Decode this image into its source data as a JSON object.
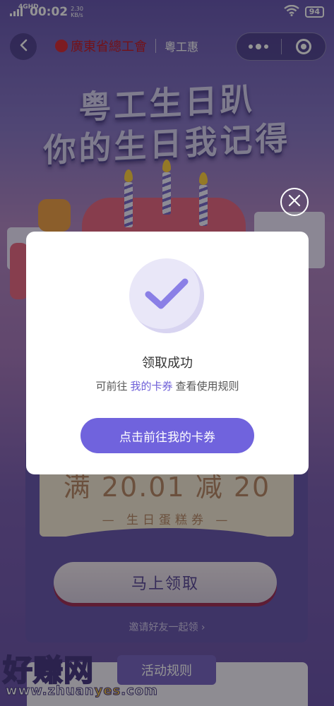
{
  "status_bar": {
    "network": "4GHD",
    "time": "00:02",
    "speed_value": "2.30",
    "speed_unit": "KB/s",
    "battery": "94"
  },
  "navbar": {
    "brand_name": "廣東省總工會",
    "brand_sub": "粵工惠"
  },
  "banner": {
    "line1": "粤工生日趴",
    "line2": "你的生日我记得"
  },
  "coupon": {
    "amount_text": "满 20.01 减 20",
    "name": "— 生日蛋糕券 —"
  },
  "claim_button": "马上领取",
  "invite_link": "邀请好友一起领 ›",
  "rules_tab": "活动规则",
  "watermark": {
    "name": "好赚网",
    "url_prefix": "www.zhuan",
    "url_highlight": "yes",
    "url_suffix": ".com"
  },
  "modal": {
    "title": "领取成功",
    "desc_prefix": "可前往",
    "desc_link": "我的卡券",
    "desc_suffix": "查看使用规则",
    "button": "点击前往我的卡券"
  },
  "colors": {
    "accent": "#7063dd",
    "link": "#6e5fd8",
    "coupon_text": "#b88b6a"
  },
  "icons": [
    "back-arrow-icon",
    "more-dots-icon",
    "mini-program-close-icon",
    "checkmark-icon",
    "close-circle-icon",
    "wifi-icon",
    "signal-icon"
  ]
}
